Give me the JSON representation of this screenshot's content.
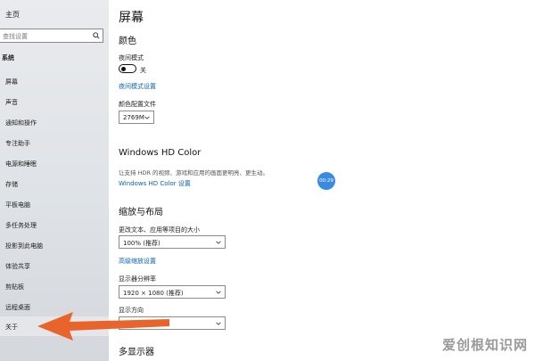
{
  "sidebar": {
    "home": "主页",
    "search_placeholder": "查找设置",
    "section": "系统",
    "items": [
      {
        "label": "屏幕"
      },
      {
        "label": "声音"
      },
      {
        "label": "通知和操作"
      },
      {
        "label": "专注助手"
      },
      {
        "label": "电源和睡眠"
      },
      {
        "label": "存储"
      },
      {
        "label": "平板电脑"
      },
      {
        "label": "多任务处理"
      },
      {
        "label": "投影到此电脑"
      },
      {
        "label": "体验共享"
      },
      {
        "label": "剪贴板"
      },
      {
        "label": "远程桌面"
      },
      {
        "label": "关于"
      }
    ]
  },
  "content": {
    "title": "屏幕",
    "color_heading": "颜色",
    "night_mode_label": "夜间模式",
    "night_toggle_state": "关",
    "night_settings_link": "夜间模式设置",
    "color_profile_label": "颜色配置文件",
    "color_profile_value": "2769M",
    "hd_heading": "Windows HD Color",
    "hd_desc": "让支持 HDR 的视频、游戏和应用的画面更明亮、更生动。",
    "hd_link": "Windows HD Color 设置",
    "time_badge": "00:29",
    "scale_heading": "缩放与布局",
    "text_size_label": "更改文本、应用等项目的大小",
    "text_size_value": "100% (推荐)",
    "advanced_scale_link": "高级缩放设置",
    "resolution_label": "显示器分辨率",
    "resolution_value": "1920 × 1080 (推荐)",
    "orientation_label": "显示方向",
    "multi_display_heading": "多显示器"
  },
  "watermark": "爱创根知识网",
  "colors": {
    "accent": "#0a63b5",
    "arrow": "#e8642a",
    "badge": "#3a8be0"
  }
}
